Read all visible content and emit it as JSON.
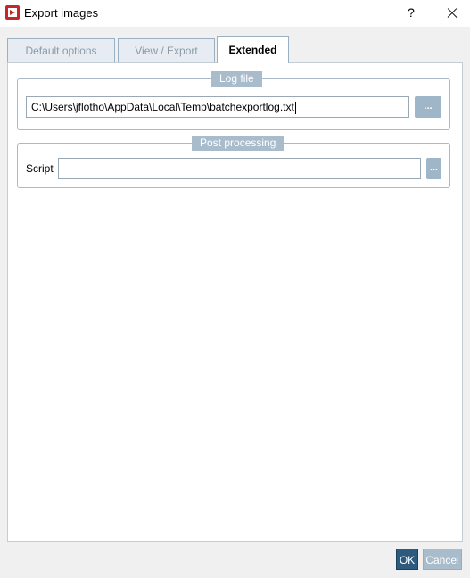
{
  "window": {
    "title": "Export images",
    "help_label": "?"
  },
  "tabs": [
    {
      "label": "Default options",
      "active": false
    },
    {
      "label": "View / Export",
      "active": false
    },
    {
      "label": "Extended",
      "active": true
    }
  ],
  "log_file": {
    "title": "Log file",
    "path_value": "C:\\Users\\jflotho\\AppData\\Local\\Temp\\batchexportlog.txt",
    "browse_label": "..."
  },
  "post_processing": {
    "title": "Post processing",
    "script_label": "Script",
    "script_value": "",
    "browse_label": "..."
  },
  "footer": {
    "ok_label": "OK",
    "cancel_label": "Cancel"
  },
  "colors": {
    "ok_button": "#2d5b7e",
    "cancel_button": "#a8bccc",
    "group_title": "#a9bccc",
    "app_icon": "#c62828"
  }
}
